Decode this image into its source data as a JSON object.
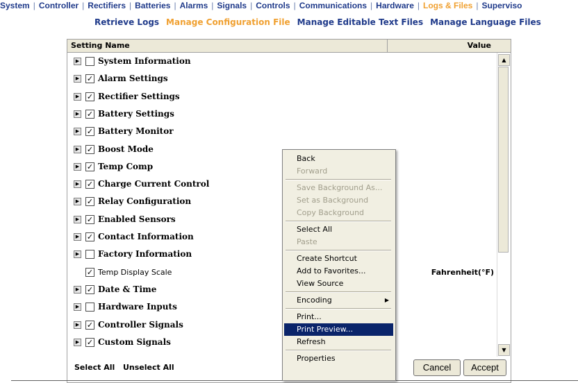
{
  "topnav": {
    "items": [
      {
        "label": "System"
      },
      {
        "label": "Controller"
      },
      {
        "label": "Rectifiers"
      },
      {
        "label": "Batteries"
      },
      {
        "label": "Alarms"
      },
      {
        "label": "Signals"
      },
      {
        "label": "Controls"
      },
      {
        "label": "Communications"
      },
      {
        "label": "Hardware"
      },
      {
        "label": "Logs & Files",
        "active": true
      },
      {
        "label": "Superviso"
      }
    ],
    "separator": "|"
  },
  "subnav": {
    "items": [
      {
        "label": "Retrieve Logs"
      },
      {
        "label": "Manage Configuration File",
        "active": true
      },
      {
        "label": "Manage Editable Text Files"
      },
      {
        "label": "Manage Language Files"
      }
    ]
  },
  "table": {
    "header_name": "Setting Name",
    "header_value": "Value",
    "rows": [
      {
        "label": "System Information",
        "checked": false,
        "expandable": true
      },
      {
        "label": "Alarm Settings",
        "checked": true,
        "expandable": true
      },
      {
        "label": "Rectifier Settings",
        "checked": true,
        "expandable": true
      },
      {
        "label": "Battery Settings",
        "checked": true,
        "expandable": true
      },
      {
        "label": "Battery Monitor",
        "checked": true,
        "expandable": true
      },
      {
        "label": "Boost Mode",
        "checked": true,
        "expandable": true
      },
      {
        "label": "Temp Comp",
        "checked": true,
        "expandable": true
      },
      {
        "label": "Charge Current Control",
        "checked": true,
        "expandable": true
      },
      {
        "label": "Relay Configuration",
        "checked": true,
        "expandable": true
      },
      {
        "label": "Enabled Sensors",
        "checked": true,
        "expandable": true
      },
      {
        "label": "Contact Information",
        "checked": true,
        "expandable": true
      },
      {
        "label": "Factory Information",
        "checked": false,
        "expandable": true
      },
      {
        "label": "Temp Display Scale",
        "checked": true,
        "expandable": false,
        "value": "Fahrenheit(°F)"
      },
      {
        "label": "Date & Time",
        "checked": true,
        "expandable": true
      },
      {
        "label": "Hardware Inputs",
        "checked": false,
        "expandable": true
      },
      {
        "label": "Controller Signals",
        "checked": true,
        "expandable": true
      },
      {
        "label": "Custom Signals",
        "checked": true,
        "expandable": true
      }
    ]
  },
  "footer": {
    "select_all": "Select All",
    "unselect_all": "Unselect All",
    "cancel": "Cancel",
    "accept": "Accept"
  },
  "context_menu": {
    "groups": [
      [
        {
          "label": "Back"
        },
        {
          "label": "Forward",
          "disabled": true
        }
      ],
      [
        {
          "label": "Save Background As...",
          "disabled": true
        },
        {
          "label": "Set as Background",
          "disabled": true
        },
        {
          "label": "Copy Background",
          "disabled": true
        }
      ],
      [
        {
          "label": "Select All"
        },
        {
          "label": "Paste",
          "disabled": true
        }
      ],
      [
        {
          "label": "Create Shortcut"
        },
        {
          "label": "Add to Favorites..."
        },
        {
          "label": "View Source"
        }
      ],
      [
        {
          "label": "Encoding",
          "submenu": true
        }
      ],
      [
        {
          "label": "Print..."
        },
        {
          "label": "Print Preview...",
          "highlighted": true
        },
        {
          "label": "Refresh"
        }
      ],
      [
        {
          "label": "Properties"
        }
      ]
    ]
  },
  "icons": {
    "expander": "expand-arrow-icon",
    "checkbox": "checkbox-icon",
    "scroll_up": "scroll-up-arrow-icon",
    "scroll_down": "scroll-down-arrow-icon",
    "submenu": "submenu-arrow-icon"
  },
  "colors": {
    "nav_link": "#1f3a8a",
    "nav_active": "#f0a030",
    "menu_highlight": "#0a246a",
    "chrome": "#ece9d8"
  }
}
